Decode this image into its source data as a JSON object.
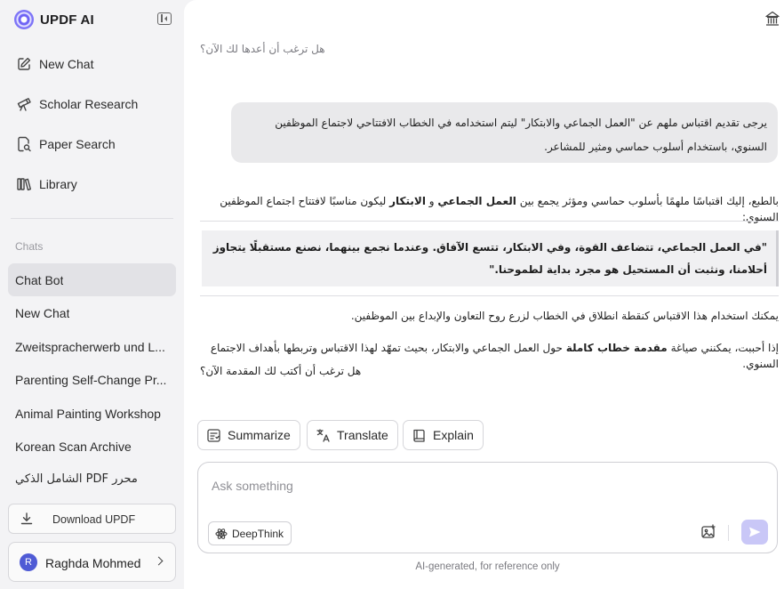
{
  "app": {
    "name": "UPDF AI"
  },
  "nav": {
    "new_chat": "New Chat",
    "scholar_research": "Scholar Research",
    "paper_search": "Paper Search",
    "library": "Library"
  },
  "chats": {
    "heading": "Chats",
    "items": [
      {
        "label": "Chat Bot"
      },
      {
        "label": "New Chat"
      },
      {
        "label": "Zweitspracherwerb und L..."
      },
      {
        "label": "Parenting Self-Change Pr..."
      },
      {
        "label": "Animal Painting Workshop"
      },
      {
        "label": "Korean Scan Archive"
      },
      {
        "label": "محرر PDF الشامل الذكي"
      }
    ]
  },
  "sidebar_footer": {
    "download_label": "Download UPDF",
    "user_initial": "R",
    "user_name": "Raghda Mohmed"
  },
  "conversation": {
    "previous_question": "هل ترغب أن أعدها لك الآن؟",
    "user_message": "يرجى تقديم اقتباس ملهم عن \"العمل الجماعي والابتكار\" ليتم استخدامه في الخطاب الافتتاحي لاجتماع الموظفين السنوي، باستخدام أسلوب حماسي ومثير للمشاعر.",
    "answer": {
      "intro_1": "بالطبع، إليك اقتباسًا ملهمًا بأسلوب حماسي ومؤثر يجمع بين ",
      "intro_b1": "العمل الجماعي",
      "intro_2": " و ",
      "intro_b2": "الابتكار",
      "intro_3": " ليكون مناسبًا لافتتاح اجتماع الموظفين السنوي:",
      "quote": "\"في العمل الجماعي، تتضاعف القوة، وفي الابتكار، تتسع الآفاق. وعندما نجمع بينهما، نصنع مستقبلًا يتجاوز أحلامنا، ونثبت أن المستحيل هو مجرد بداية لطموحنا.\"",
      "line_1": "يمكنك استخدام هذا الاقتباس كنقطة انطلاق في الخطاب لزرع روح التعاون والإبداع بين الموظفين.",
      "line_2a": "إذا أحببت، يمكنني صياغة ",
      "line_2b": "مقدمة خطاب كاملة",
      "line_2c": " حول العمل الجماعي والابتكار، بحيث تمهّد لهذا الاقتباس وتربطها بأهداف الاجتماع السنوي.",
      "line_3": "هل ترغب أن أكتب لك المقدمة الآن؟"
    }
  },
  "actions": {
    "summarize": "Summarize",
    "translate": "Translate",
    "explain": "Explain"
  },
  "composer": {
    "placeholder": "Ask something",
    "value": "",
    "deepthink": "DeepThink"
  },
  "footer": {
    "disclaimer": "AI-generated, for reference only"
  },
  "colors": {
    "accent": "#6e63f5",
    "send_button": "#c9c7f7",
    "sidebar_bg": "#f3f3f5",
    "active_chat_bg": "#e2e2e6",
    "user_bubble_bg": "#e9e9eb",
    "quote_bg": "#f0f0f2"
  },
  "icons": {
    "brand": "updf-ai-logo",
    "collapse": "sidebar-collapse-icon",
    "new_chat": "edit-icon",
    "scholar": "telescope-icon",
    "paper_search": "search-document-icon",
    "library": "library-icon",
    "download": "download-icon",
    "top_right": "bank-icon",
    "summarize": "summarize-icon",
    "translate": "translate-icon",
    "explain": "book-icon",
    "deepthink": "atom-icon",
    "image_upload": "image-plus-icon",
    "send": "send-icon"
  }
}
